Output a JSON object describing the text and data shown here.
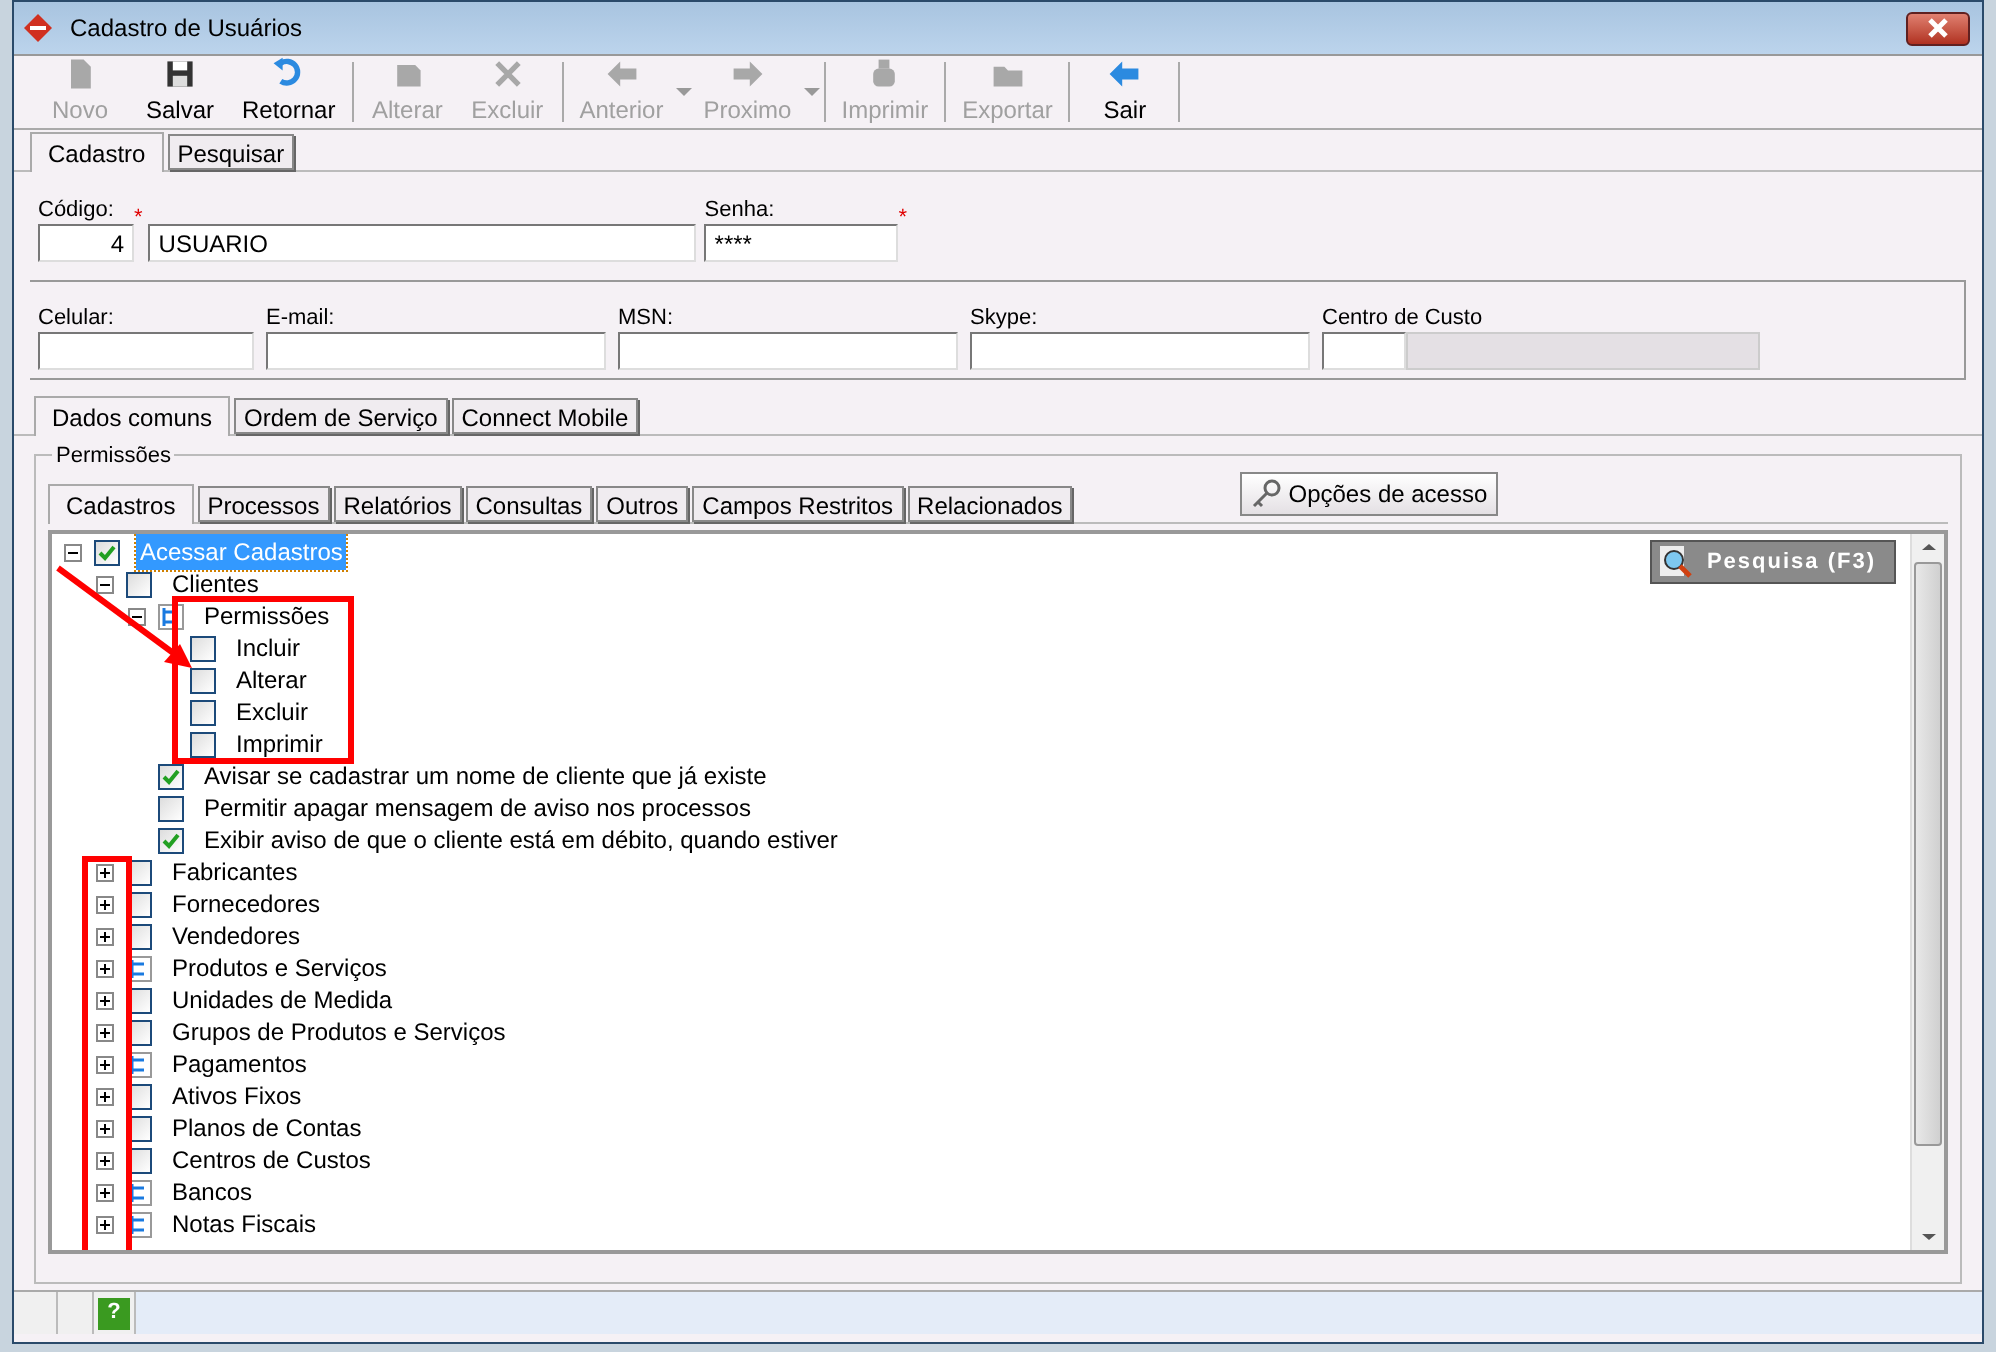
{
  "window": {
    "title": "Cadastro de Usuários"
  },
  "toolbar": [
    {
      "label": "Novo",
      "disabled": true,
      "kind": "new"
    },
    {
      "label": "Salvar",
      "disabled": false,
      "kind": "save"
    },
    {
      "label": "Retornar",
      "disabled": false,
      "kind": "undo"
    },
    {
      "label": "Alterar",
      "disabled": true,
      "kind": "edit",
      "group_start": true
    },
    {
      "label": "Excluir",
      "disabled": true,
      "kind": "delete"
    },
    {
      "label": "Anterior",
      "disabled": true,
      "kind": "left",
      "group_start": true,
      "has_menu": true
    },
    {
      "label": "Proximo",
      "disabled": true,
      "kind": "right",
      "has_menu": true
    },
    {
      "label": "Imprimir",
      "disabled": true,
      "kind": "print",
      "group_start": true
    },
    {
      "label": "Exportar",
      "disabled": true,
      "kind": "export",
      "group_start": true
    },
    {
      "label": "Sair",
      "disabled": false,
      "kind": "exit",
      "group_start": true
    }
  ],
  "main_tabs": [
    {
      "label": "Cadastro",
      "selected": true
    },
    {
      "label": "Pesquisar",
      "selected": false
    }
  ],
  "fields_row1": [
    {
      "label": "Código:",
      "value": "4",
      "required_mark": "*"
    },
    {
      "value": "USUARIO"
    },
    {
      "label": "Senha:",
      "value": "****",
      "required_mark": "*"
    }
  ],
  "fields_row2": [
    {
      "label": "Celular:"
    },
    {
      "label": "E-mail:"
    },
    {
      "label": "MSN:"
    },
    {
      "label": "Skype:"
    },
    {
      "label": "Centro de Custo"
    }
  ],
  "sub_tabs": [
    {
      "label": "Dados comuns",
      "selected": true
    },
    {
      "label": "Ordem de Serviço",
      "selected": false
    },
    {
      "label": "Connect Mobile",
      "selected": false
    }
  ],
  "permissions": {
    "title": "Permissões",
    "tabs": [
      {
        "label": "Cadastros",
        "selected": true
      },
      {
        "label": "Processos",
        "selected": false
      },
      {
        "label": "Relatórios",
        "selected": false
      },
      {
        "label": "Consultas",
        "selected": false
      },
      {
        "label": "Outros",
        "selected": false
      },
      {
        "label": "Campos Restritos",
        "selected": false
      },
      {
        "label": "Relacionados",
        "selected": false
      }
    ],
    "access_button": "Opções de acesso",
    "search_button": "Pesquisa (F3)",
    "tree": [
      {
        "label": "Acessar Cadastros",
        "kind": "check",
        "checked": true,
        "selected": true,
        "expanded": true,
        "children": [
          {
            "label": "Clientes",
            "kind": "check",
            "checked": false,
            "selected": false,
            "expanded": true,
            "children": [
              {
                "label": "Permissões",
                "kind": "group",
                "selected": false,
                "expanded": true,
                "children": [
                  {
                    "label": "Incluir",
                    "kind": "check",
                    "checked": false,
                    "selected": false
                  },
                  {
                    "label": "Alterar",
                    "kind": "check",
                    "checked": false,
                    "selected": false
                  },
                  {
                    "label": "Excluir",
                    "kind": "check",
                    "checked": false,
                    "selected": false
                  },
                  {
                    "label": "Imprimir",
                    "kind": "check",
                    "checked": false,
                    "selected": false
                  }
                ]
              },
              {
                "label": "Avisar se cadastrar um nome de cliente que já existe",
                "kind": "check",
                "checked": true,
                "selected": false
              },
              {
                "label": "Permitir apagar mensagem de aviso nos processos",
                "kind": "check",
                "checked": false,
                "selected": false
              },
              {
                "label": "Exibir aviso de que o cliente está em débito, quando estiver",
                "kind": "check",
                "checked": true,
                "selected": false
              }
            ]
          },
          {
            "label": "Fabricantes",
            "kind": "check",
            "checked": false,
            "selected": false,
            "expanded": false
          },
          {
            "label": "Fornecedores",
            "kind": "check",
            "checked": false,
            "selected": false,
            "expanded": false
          },
          {
            "label": "Vendedores",
            "kind": "check",
            "checked": false,
            "selected": false,
            "expanded": false
          },
          {
            "label": "Produtos e Serviços",
            "kind": "group",
            "selected": false,
            "expanded": false
          },
          {
            "label": "Unidades de Medida",
            "kind": "check",
            "checked": false,
            "selected": false,
            "expanded": false
          },
          {
            "label": "Grupos de Produtos e Serviços",
            "kind": "check",
            "checked": false,
            "selected": false,
            "expanded": false
          },
          {
            "label": "Pagamentos",
            "kind": "group",
            "selected": false,
            "expanded": false
          },
          {
            "label": "Ativos Fixos",
            "kind": "check",
            "checked": false,
            "selected": false,
            "expanded": false
          },
          {
            "label": "Planos de Contas",
            "kind": "check",
            "checked": false,
            "selected": false,
            "expanded": false
          },
          {
            "label": "Centros de Custos",
            "kind": "check",
            "checked": false,
            "selected": false,
            "expanded": false
          },
          {
            "label": "Bancos",
            "kind": "group",
            "selected": false,
            "expanded": false
          },
          {
            "label": "Notas Fiscais",
            "kind": "group",
            "selected": false,
            "expanded": false
          }
        ]
      }
    ]
  },
  "status_bar": {
    "help": "?"
  }
}
